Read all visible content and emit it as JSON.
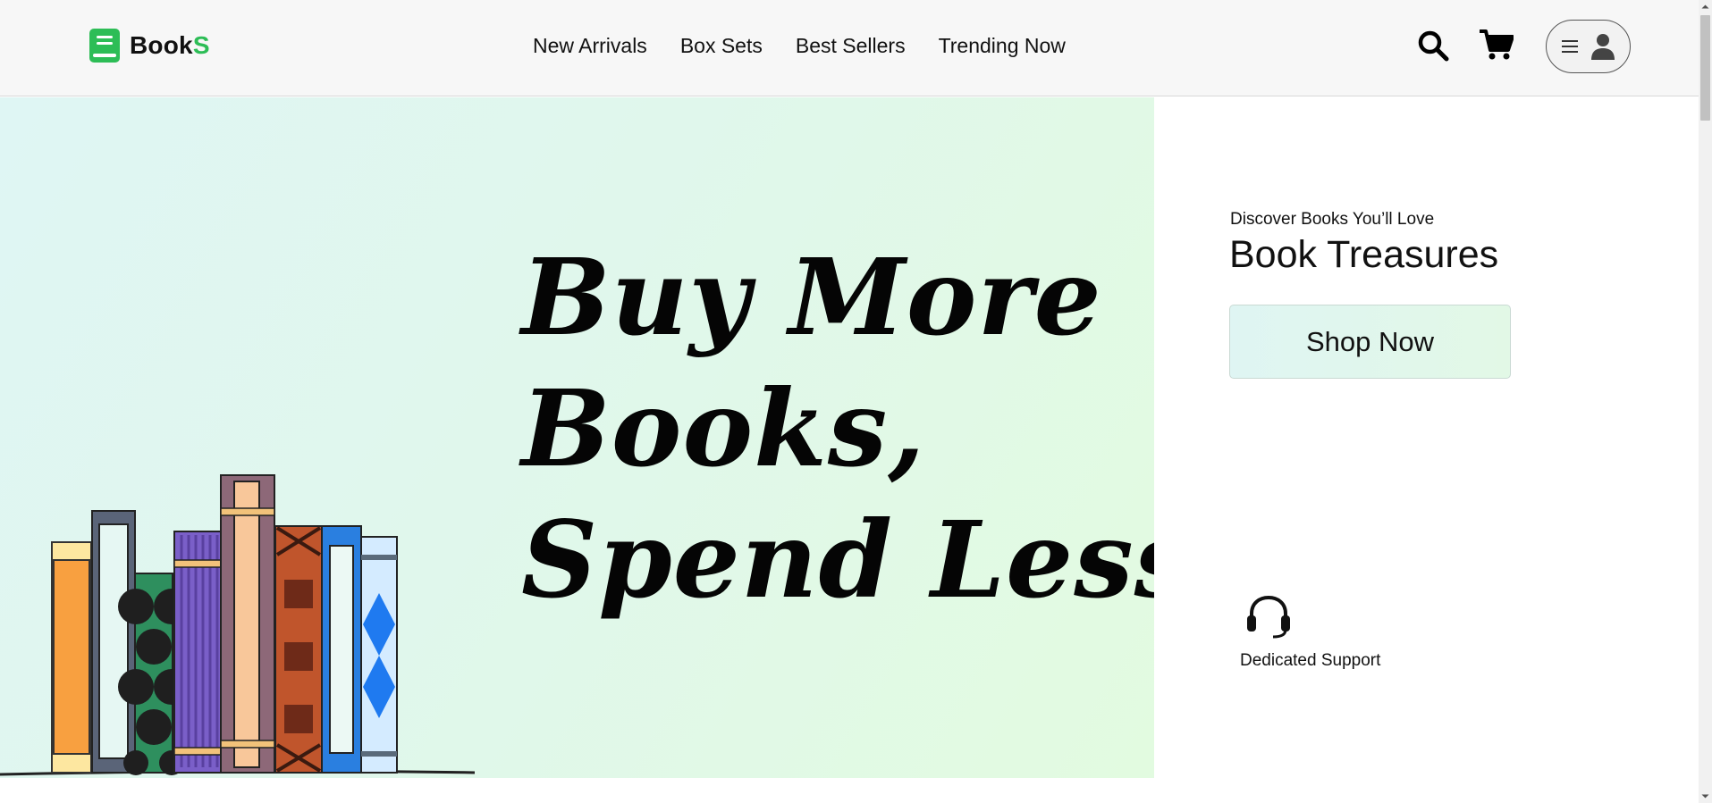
{
  "header": {
    "logo_prefix": "Book",
    "logo_accent": "S",
    "nav": [
      {
        "label": "New Arrivals"
      },
      {
        "label": "Box Sets"
      },
      {
        "label": "Best Sellers"
      },
      {
        "label": "Trending Now"
      }
    ],
    "icons": {
      "logo": "book-icon",
      "search": "search-icon",
      "cart": "cart-icon",
      "menu": "hamburger-menu-icon",
      "account": "user-icon"
    }
  },
  "hero": {
    "headline_lines": [
      "Buy More",
      "Books,",
      "Spend Less!"
    ],
    "illustration": "books-shelf-illustration"
  },
  "promo": {
    "tagline": "Discover Books You’ll Love",
    "title": "Book Treasures",
    "cta_label": "Shop Now"
  },
  "support": {
    "label": "Dedicated Support",
    "icon": "headset-icon"
  },
  "colors": {
    "brand_green": "#2dbd56",
    "header_bg": "#f7f7f7",
    "hero_gradient_start": "#dff6f4",
    "hero_gradient_end": "#e2fbe0"
  }
}
